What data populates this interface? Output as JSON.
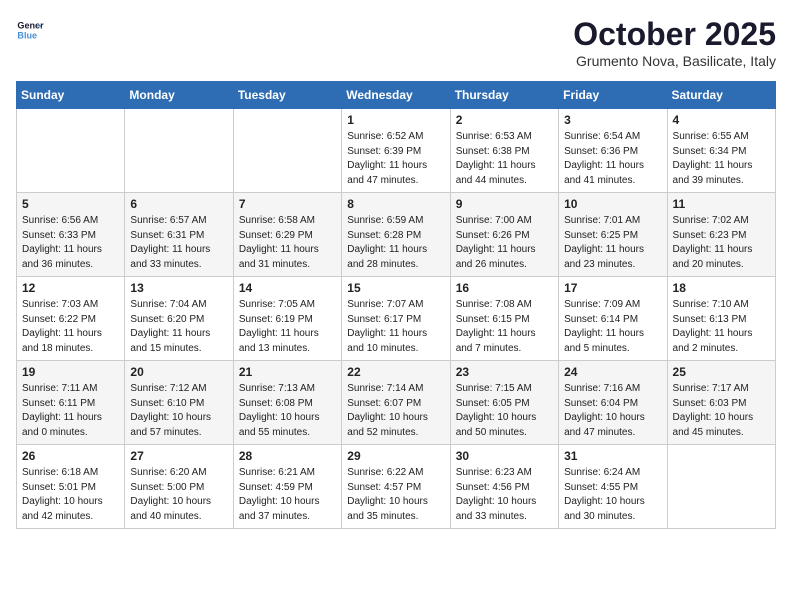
{
  "header": {
    "logo_line1": "General",
    "logo_line2": "Blue",
    "month": "October 2025",
    "location": "Grumento Nova, Basilicate, Italy"
  },
  "weekdays": [
    "Sunday",
    "Monday",
    "Tuesday",
    "Wednesday",
    "Thursday",
    "Friday",
    "Saturday"
  ],
  "weeks": [
    [
      {
        "day": "",
        "detail": ""
      },
      {
        "day": "",
        "detail": ""
      },
      {
        "day": "",
        "detail": ""
      },
      {
        "day": "1",
        "detail": "Sunrise: 6:52 AM\nSunset: 6:39 PM\nDaylight: 11 hours\nand 47 minutes."
      },
      {
        "day": "2",
        "detail": "Sunrise: 6:53 AM\nSunset: 6:38 PM\nDaylight: 11 hours\nand 44 minutes."
      },
      {
        "day": "3",
        "detail": "Sunrise: 6:54 AM\nSunset: 6:36 PM\nDaylight: 11 hours\nand 41 minutes."
      },
      {
        "day": "4",
        "detail": "Sunrise: 6:55 AM\nSunset: 6:34 PM\nDaylight: 11 hours\nand 39 minutes."
      }
    ],
    [
      {
        "day": "5",
        "detail": "Sunrise: 6:56 AM\nSunset: 6:33 PM\nDaylight: 11 hours\nand 36 minutes."
      },
      {
        "day": "6",
        "detail": "Sunrise: 6:57 AM\nSunset: 6:31 PM\nDaylight: 11 hours\nand 33 minutes."
      },
      {
        "day": "7",
        "detail": "Sunrise: 6:58 AM\nSunset: 6:29 PM\nDaylight: 11 hours\nand 31 minutes."
      },
      {
        "day": "8",
        "detail": "Sunrise: 6:59 AM\nSunset: 6:28 PM\nDaylight: 11 hours\nand 28 minutes."
      },
      {
        "day": "9",
        "detail": "Sunrise: 7:00 AM\nSunset: 6:26 PM\nDaylight: 11 hours\nand 26 minutes."
      },
      {
        "day": "10",
        "detail": "Sunrise: 7:01 AM\nSunset: 6:25 PM\nDaylight: 11 hours\nand 23 minutes."
      },
      {
        "day": "11",
        "detail": "Sunrise: 7:02 AM\nSunset: 6:23 PM\nDaylight: 11 hours\nand 20 minutes."
      }
    ],
    [
      {
        "day": "12",
        "detail": "Sunrise: 7:03 AM\nSunset: 6:22 PM\nDaylight: 11 hours\nand 18 minutes."
      },
      {
        "day": "13",
        "detail": "Sunrise: 7:04 AM\nSunset: 6:20 PM\nDaylight: 11 hours\nand 15 minutes."
      },
      {
        "day": "14",
        "detail": "Sunrise: 7:05 AM\nSunset: 6:19 PM\nDaylight: 11 hours\nand 13 minutes."
      },
      {
        "day": "15",
        "detail": "Sunrise: 7:07 AM\nSunset: 6:17 PM\nDaylight: 11 hours\nand 10 minutes."
      },
      {
        "day": "16",
        "detail": "Sunrise: 7:08 AM\nSunset: 6:15 PM\nDaylight: 11 hours\nand 7 minutes."
      },
      {
        "day": "17",
        "detail": "Sunrise: 7:09 AM\nSunset: 6:14 PM\nDaylight: 11 hours\nand 5 minutes."
      },
      {
        "day": "18",
        "detail": "Sunrise: 7:10 AM\nSunset: 6:13 PM\nDaylight: 11 hours\nand 2 minutes."
      }
    ],
    [
      {
        "day": "19",
        "detail": "Sunrise: 7:11 AM\nSunset: 6:11 PM\nDaylight: 11 hours\nand 0 minutes."
      },
      {
        "day": "20",
        "detail": "Sunrise: 7:12 AM\nSunset: 6:10 PM\nDaylight: 10 hours\nand 57 minutes."
      },
      {
        "day": "21",
        "detail": "Sunrise: 7:13 AM\nSunset: 6:08 PM\nDaylight: 10 hours\nand 55 minutes."
      },
      {
        "day": "22",
        "detail": "Sunrise: 7:14 AM\nSunset: 6:07 PM\nDaylight: 10 hours\nand 52 minutes."
      },
      {
        "day": "23",
        "detail": "Sunrise: 7:15 AM\nSunset: 6:05 PM\nDaylight: 10 hours\nand 50 minutes."
      },
      {
        "day": "24",
        "detail": "Sunrise: 7:16 AM\nSunset: 6:04 PM\nDaylight: 10 hours\nand 47 minutes."
      },
      {
        "day": "25",
        "detail": "Sunrise: 7:17 AM\nSunset: 6:03 PM\nDaylight: 10 hours\nand 45 minutes."
      }
    ],
    [
      {
        "day": "26",
        "detail": "Sunrise: 6:18 AM\nSunset: 5:01 PM\nDaylight: 10 hours\nand 42 minutes."
      },
      {
        "day": "27",
        "detail": "Sunrise: 6:20 AM\nSunset: 5:00 PM\nDaylight: 10 hours\nand 40 minutes."
      },
      {
        "day": "28",
        "detail": "Sunrise: 6:21 AM\nSunset: 4:59 PM\nDaylight: 10 hours\nand 37 minutes."
      },
      {
        "day": "29",
        "detail": "Sunrise: 6:22 AM\nSunset: 4:57 PM\nDaylight: 10 hours\nand 35 minutes."
      },
      {
        "day": "30",
        "detail": "Sunrise: 6:23 AM\nSunset: 4:56 PM\nDaylight: 10 hours\nand 33 minutes."
      },
      {
        "day": "31",
        "detail": "Sunrise: 6:24 AM\nSunset: 4:55 PM\nDaylight: 10 hours\nand 30 minutes."
      },
      {
        "day": "",
        "detail": ""
      }
    ]
  ]
}
